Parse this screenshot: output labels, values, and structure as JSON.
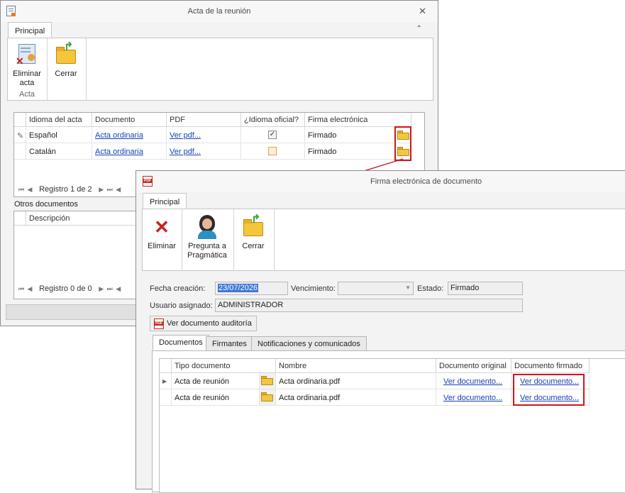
{
  "win1": {
    "title": "Acta de la reunión",
    "tab": "Principal",
    "buttons": {
      "delete": "Eliminar acta",
      "close": "Cerrar"
    },
    "group_label": "Acta",
    "grid": {
      "headers": [
        "Idioma del acta",
        "Documento",
        "PDF",
        "¿Idioma oficial?",
        "Firma electrónica"
      ],
      "rows": [
        {
          "idioma": "Español",
          "documento": "Acta ordinaria",
          "pdf": "Ver pdf...",
          "oficial": true,
          "firma": "Firmado"
        },
        {
          "idioma": "Catalán",
          "documento": "Acta ordinaria",
          "pdf": "Ver pdf...",
          "oficial": false,
          "firma": "Firmado"
        }
      ],
      "record": "Registro 1 de 2"
    },
    "otros": {
      "label": "Otros documentos",
      "header": "Descripción",
      "record": "Registro 0 de 0"
    }
  },
  "win2": {
    "title": "Firma electrónica de documento",
    "tab": "Principal",
    "buttons": {
      "delete": "Eliminar",
      "ask": "Pregunta a Pragmática",
      "close": "Cerrar"
    },
    "form": {
      "fecha_label": "Fecha creación:",
      "fecha_value": "23/07/2026",
      "venc_label": "Vencimiento:",
      "venc_value": "",
      "estado_label": "Estado:",
      "estado_value": "Firmado",
      "usuario_label": "Usuario asignado:",
      "usuario_value": "ADMINISTRADOR"
    },
    "audit_button": "Ver documento auditoría",
    "tabs": [
      "Documentos",
      "Firmantes",
      "Notificaciones y comunicados"
    ],
    "grid": {
      "headers": [
        "Tipo documento",
        "Nombre",
        "Documento original",
        "Documento firmado"
      ],
      "rows": [
        {
          "tipo": "Acta de reunión",
          "nombre": "Acta ordinaria.pdf",
          "original": "Ver documento...",
          "firmado": "Ver documento..."
        },
        {
          "tipo": "Acta de reunión",
          "nombre": "Acta ordinaria.pdf",
          "original": "Ver documento...",
          "firmado": "Ver documento..."
        }
      ]
    }
  },
  "colors": {
    "highlight": "#d0141e",
    "link": "#1a3fb4",
    "selection": "#3e78d4"
  }
}
